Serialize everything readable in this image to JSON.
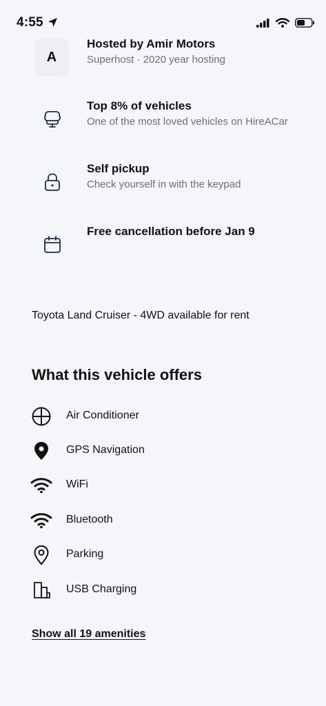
{
  "status_bar": {
    "time": "4:55",
    "icons": [
      "location-arrow-icon",
      "cellular-signal-icon",
      "wifi-icon",
      "battery-icon"
    ]
  },
  "host": {
    "avatar_letter": "A",
    "title": "Hosted by Amir Motors",
    "subtitle": "Superhost · 2020 year hosting"
  },
  "features": [
    {
      "icon": "trophy-icon",
      "title": "Top 8% of vehicles",
      "subtitle": "One of the most loved vehicles on HireACar"
    },
    {
      "icon": "lock-icon",
      "title": "Self pickup",
      "subtitle": "Check yourself in with the keypad"
    },
    {
      "icon": "calendar-icon",
      "title": "Free cancellation before Jan 9",
      "subtitle": ""
    }
  ],
  "description": "Toyota Land Cruiser - 4WD available for rent",
  "offers": {
    "title": "What this vehicle offers",
    "items": [
      {
        "icon": "air-conditioner-icon",
        "label": "Air Conditioner"
      },
      {
        "icon": "map-pin-filled-icon",
        "label": "GPS Navigation"
      },
      {
        "icon": "wifi-icon",
        "label": "WiFi"
      },
      {
        "icon": "bluetooth-signal-icon",
        "label": "Bluetooth"
      },
      {
        "icon": "map-pin-outline-icon",
        "label": "Parking"
      },
      {
        "icon": "usb-charging-icon",
        "label": "USB Charging"
      }
    ],
    "show_all_label": "Show all 19 amenities"
  },
  "colors": {
    "background": "#f5f6fa",
    "text_primary": "#111111",
    "text_secondary": "#6b6e75",
    "icon_navy": "#1d2a44",
    "avatar_bg": "#eeeff3"
  }
}
